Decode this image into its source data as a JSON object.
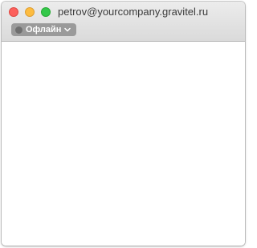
{
  "window": {
    "title": "petrov@yourcompany.gravitel.ru"
  },
  "status": {
    "label": "Офлайн",
    "dot_color": "#6f6f6f",
    "icon": "chevron-down-icon"
  },
  "colors": {
    "close": "#fc605c",
    "minimize": "#fdbc40",
    "maximize": "#34c84a"
  }
}
